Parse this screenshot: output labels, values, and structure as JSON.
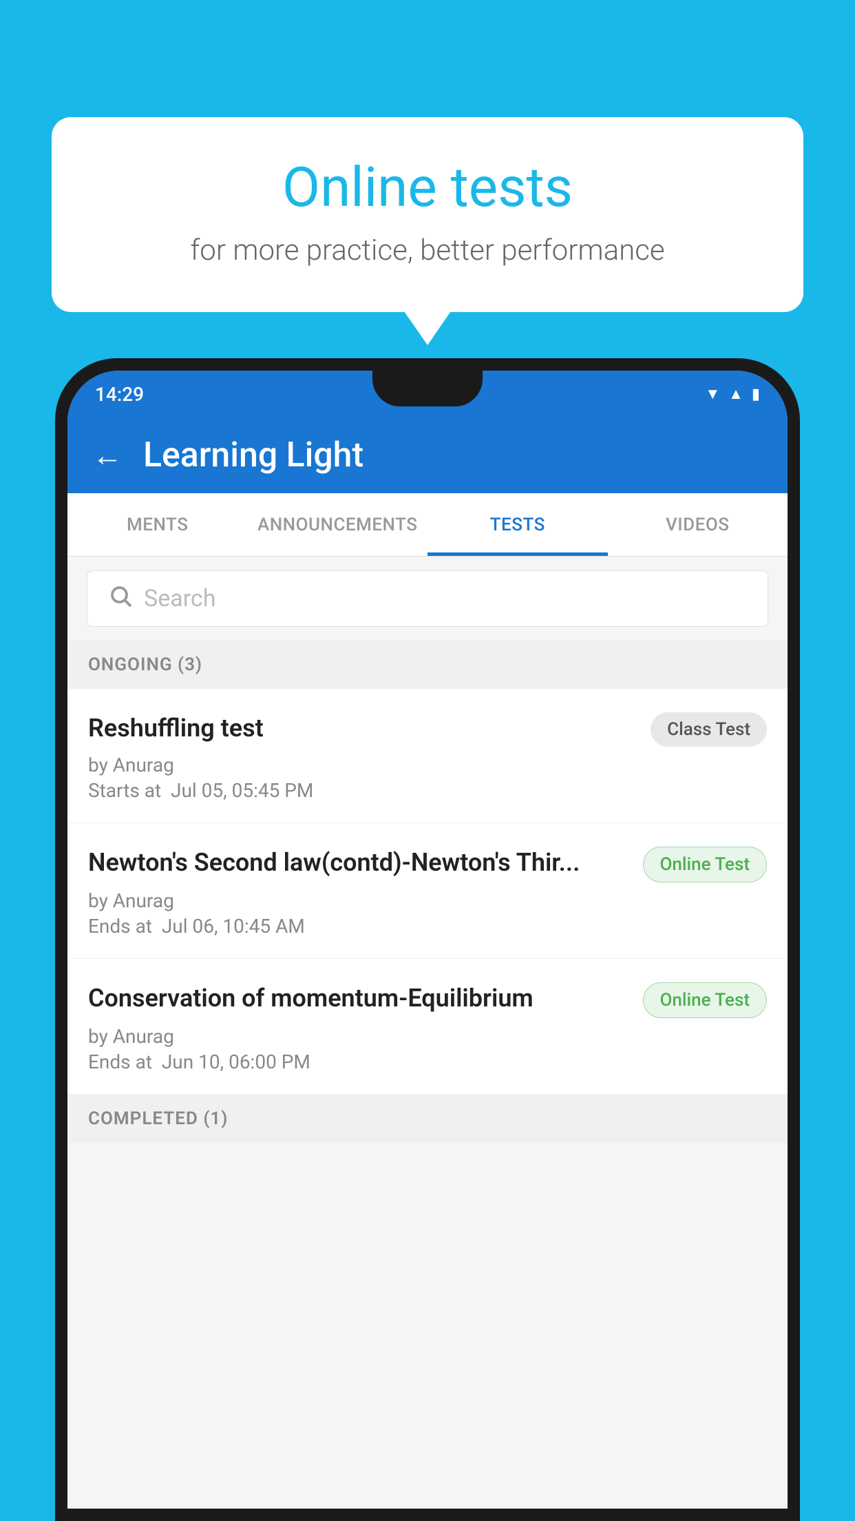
{
  "background_color": "#1ab8e8",
  "speech_bubble": {
    "title": "Online tests",
    "subtitle": "for more practice, better performance"
  },
  "phone": {
    "status_bar": {
      "time": "14:29",
      "icons": [
        "wifi",
        "signal",
        "battery"
      ]
    },
    "app_bar": {
      "back_label": "←",
      "title": "Learning Light"
    },
    "tabs": [
      {
        "label": "MENTS",
        "active": false
      },
      {
        "label": "ANNOUNCEMENTS",
        "active": false
      },
      {
        "label": "TESTS",
        "active": true
      },
      {
        "label": "VIDEOS",
        "active": false
      }
    ],
    "search": {
      "placeholder": "Search"
    },
    "ongoing_section": {
      "label": "ONGOING (3)"
    },
    "tests": [
      {
        "title": "Reshuffling test",
        "badge": "Class Test",
        "badge_type": "class",
        "by": "by Anurag",
        "time_label": "Starts at",
        "time": "Jul 05, 05:45 PM"
      },
      {
        "title": "Newton's Second law(contd)-Newton's Thir...",
        "badge": "Online Test",
        "badge_type": "online",
        "by": "by Anurag",
        "time_label": "Ends at",
        "time": "Jul 06, 10:45 AM"
      },
      {
        "title": "Conservation of momentum-Equilibrium",
        "badge": "Online Test",
        "badge_type": "online",
        "by": "by Anurag",
        "time_label": "Ends at",
        "time": "Jun 10, 06:00 PM"
      }
    ],
    "completed_section": {
      "label": "COMPLETED (1)"
    }
  }
}
